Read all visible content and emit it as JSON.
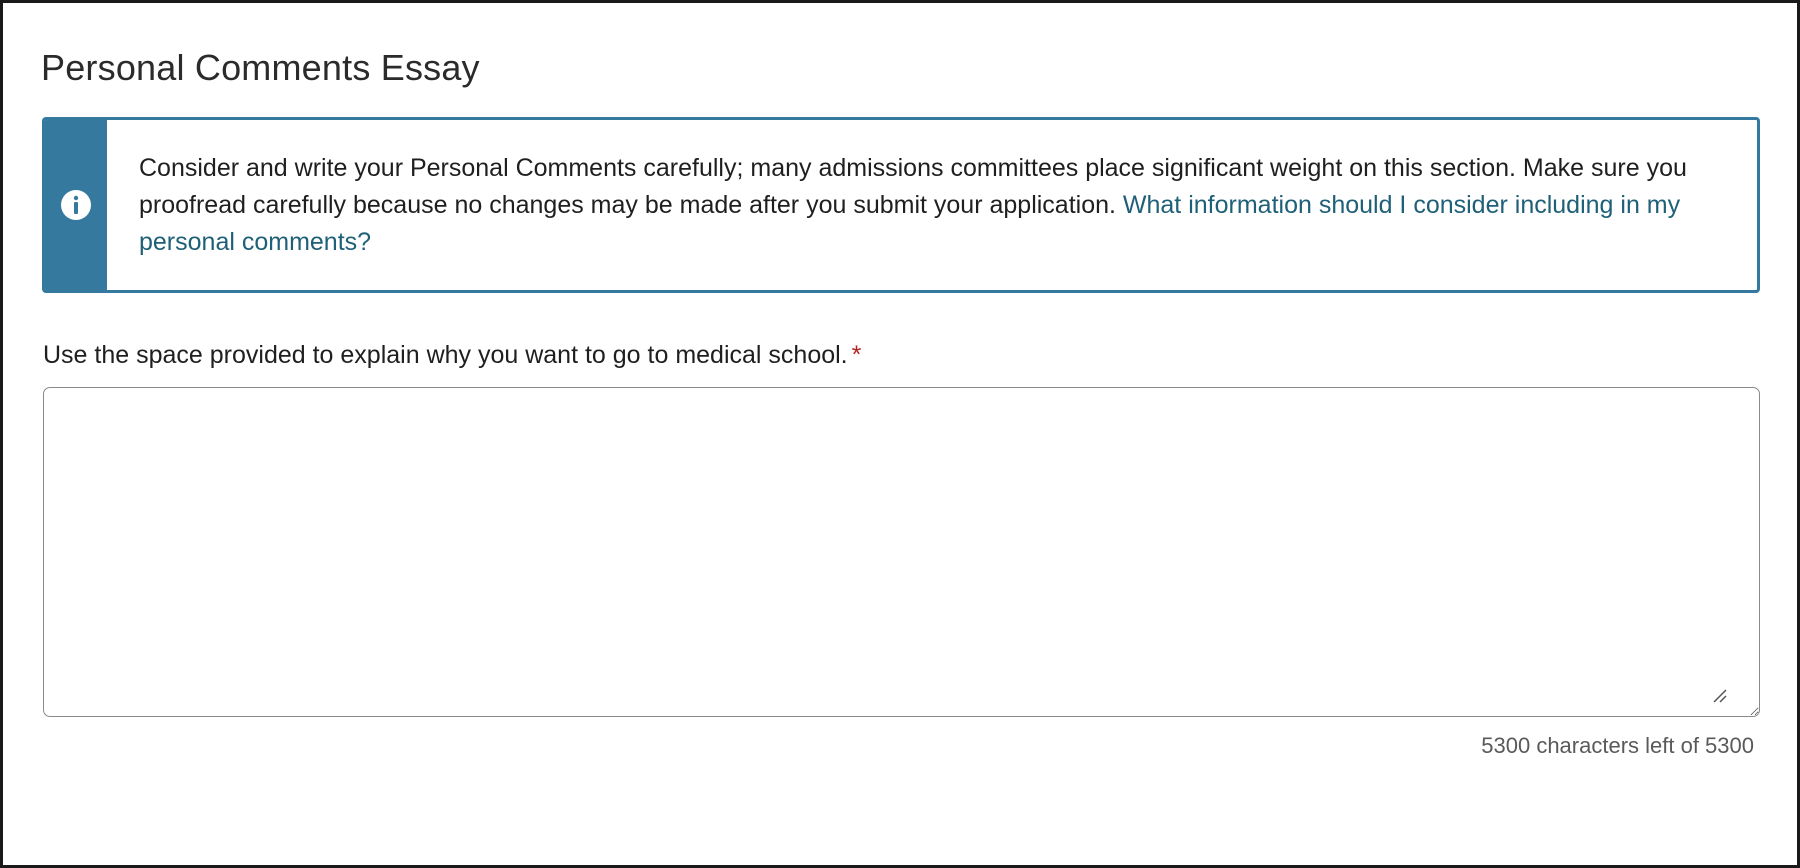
{
  "page": {
    "title": "Personal Comments Essay"
  },
  "info_box": {
    "icon": "info-icon",
    "text": "Consider and write your Personal Comments carefully; many admissions committees place significant weight on this section. Make sure you proofread carefully because no changes may be made after you submit your application. ",
    "link_text": "What information should I consider including in my personal comments?",
    "accent_color": "#35799f",
    "link_color": "#1f6078"
  },
  "essay_field": {
    "label": "Use the space provided to explain why you want to go to medical school.",
    "required_marker": "*",
    "value": "",
    "counter_text": "5300 characters left of 5300"
  }
}
